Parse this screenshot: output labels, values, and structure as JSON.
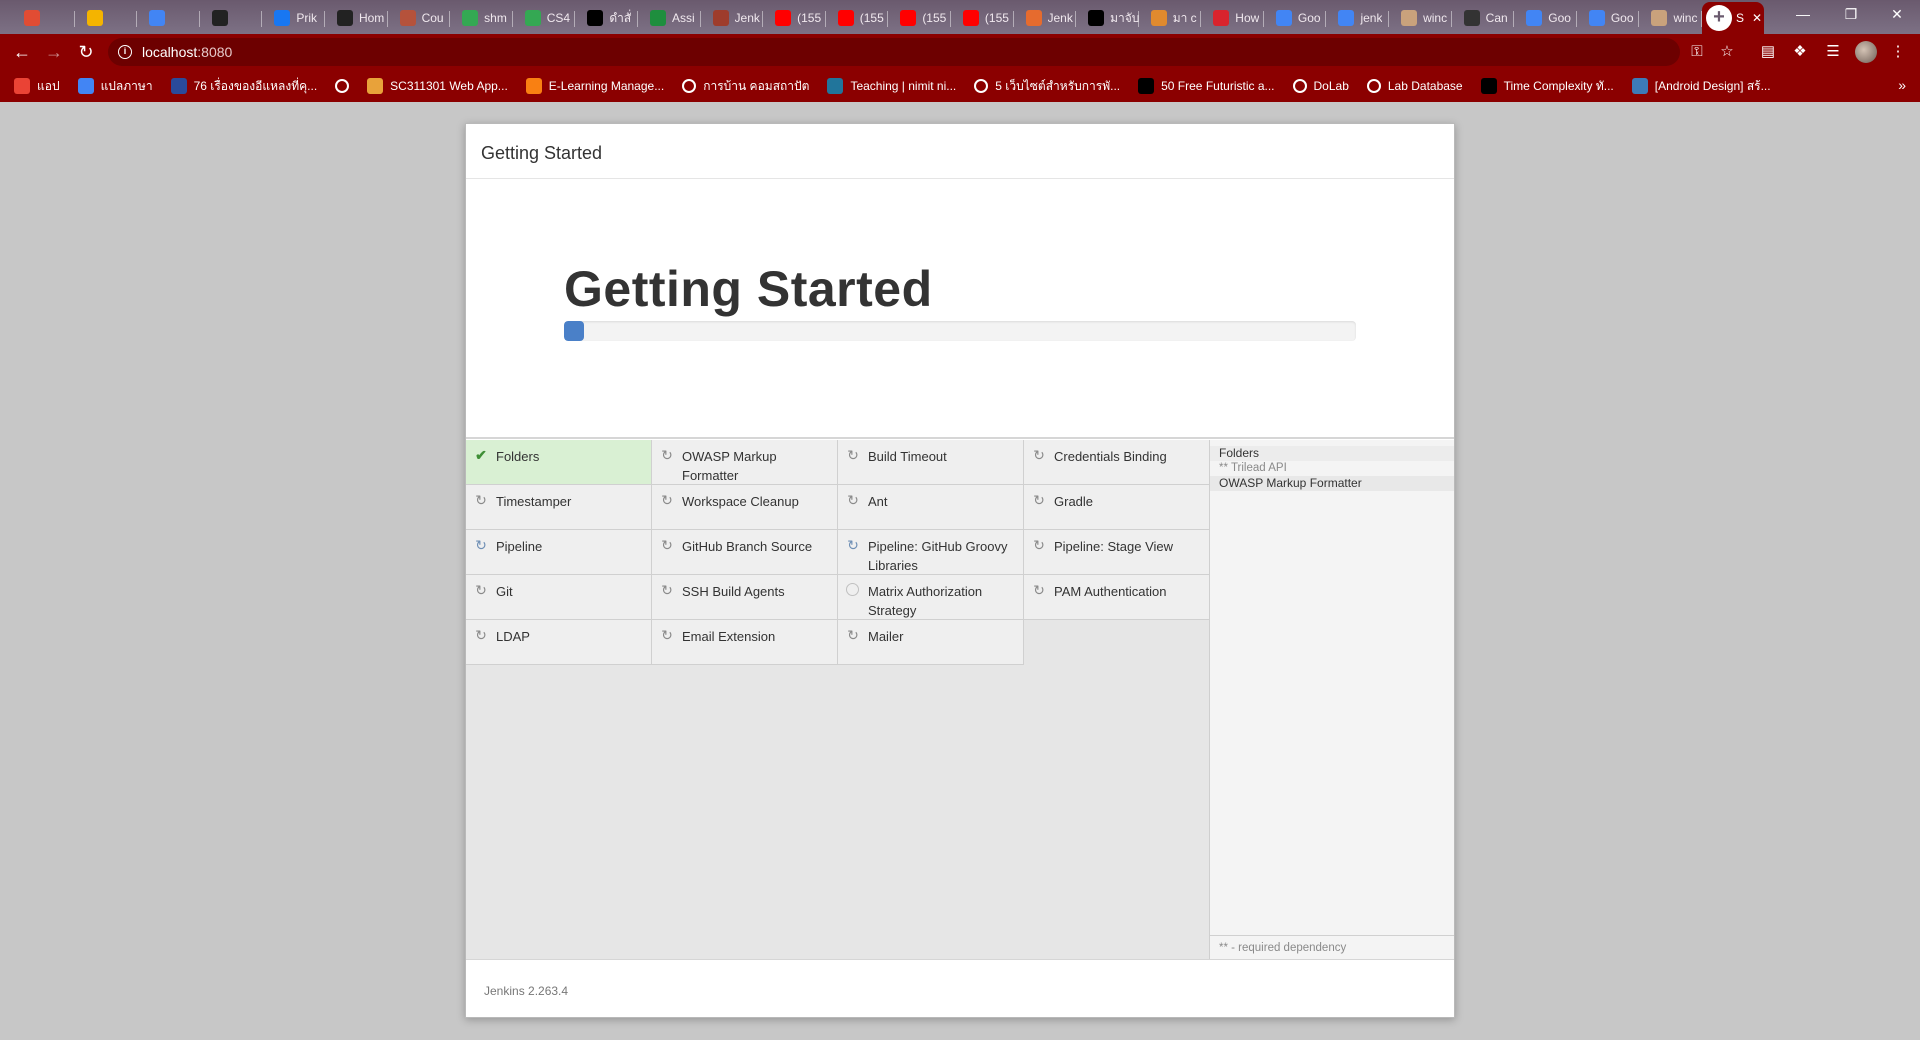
{
  "browser": {
    "tabs": [
      {
        "title": "",
        "icon": "warning-icon",
        "color": "#e14c33"
      },
      {
        "title": "",
        "icon": "drive-icon",
        "color": "#f4b400"
      },
      {
        "title": "",
        "icon": "contacts-icon",
        "color": "#4285f4"
      },
      {
        "title": "",
        "icon": "github-icon",
        "color": "#222222"
      },
      {
        "title": "Prik",
        "icon": "facebook-icon",
        "color": "#1877f2"
      },
      {
        "title": "Hom",
        "icon": "github-icon",
        "color": "#222222"
      },
      {
        "title": "Cou",
        "icon": "coursera-icon",
        "color": "#b5523b"
      },
      {
        "title": "shm",
        "icon": "drive-icon",
        "color": "#34a853"
      },
      {
        "title": "CS4",
        "icon": "drive-icon",
        "color": "#34a853"
      },
      {
        "title": "ดำสั่",
        "icon": "medium-icon",
        "color": "#000000"
      },
      {
        "title": "Assi",
        "icon": "classroom-icon",
        "color": "#1e8e3e"
      },
      {
        "title": "Jenk",
        "icon": "jenkins-icon",
        "color": "#9e3c2c"
      },
      {
        "title": "(155",
        "icon": "youtube-icon",
        "color": "#ff0000"
      },
      {
        "title": "(155",
        "icon": "youtube-icon",
        "color": "#ff0000"
      },
      {
        "title": "(155",
        "icon": "youtube-icon",
        "color": "#ff0000"
      },
      {
        "title": "(155",
        "icon": "youtube-icon",
        "color": "#ff0000"
      },
      {
        "title": "Jenk",
        "icon": "jenkins-icon",
        "color": "#e66b2e"
      },
      {
        "title": "มาจับ",
        "icon": "medium-icon",
        "color": "#000000"
      },
      {
        "title": "มา c",
        "icon": "gear-icon",
        "color": "#e08a2e"
      },
      {
        "title": "How",
        "icon": "codeonline-icon",
        "color": "#d9232d"
      },
      {
        "title": "Goo",
        "icon": "translate-icon",
        "color": "#4285f4"
      },
      {
        "title": "jenk",
        "icon": "google-icon",
        "color": "#4285f4"
      },
      {
        "title": "winc",
        "icon": "windows-icon",
        "color": "#c9a27c"
      },
      {
        "title": "Can",
        "icon": "canvas-icon",
        "color": "#333333"
      },
      {
        "title": "Goo",
        "icon": "translate-icon",
        "color": "#4285f4"
      },
      {
        "title": "Goo",
        "icon": "translate-icon",
        "color": "#4285f4"
      },
      {
        "title": "winc",
        "icon": "windows-icon",
        "color": "#c9a27c"
      },
      {
        "title": "S",
        "icon": "jenkins-icon",
        "color": "#bba18a",
        "active": true
      }
    ],
    "new_tab_label": "+",
    "window_controls": {
      "minimize": "—",
      "restore": "❐",
      "close": "✕"
    },
    "url_host": "localhost",
    "url_port": ":8080",
    "bookmarks": [
      {
        "label": "แอป",
        "icon": "apps-icon",
        "color": "#ea4335"
      },
      {
        "label": "แปลภาษา",
        "icon": "translate-icon",
        "color": "#4285f4"
      },
      {
        "label": "76 เรื่องของอีแหลงที่คุ...",
        "icon": "blog-icon",
        "color": "#2a4a9b"
      },
      {
        "label": "",
        "icon": "globe-icon",
        "color": "#ffffff"
      },
      {
        "label": "SC311301 Web App...",
        "icon": "course-icon",
        "color": "#e8a23a"
      },
      {
        "label": "E-Learning Manage...",
        "icon": "moodle-icon",
        "color": "#f98012"
      },
      {
        "label": "การบ้าน คอมสถาปัต",
        "icon": "globe-icon",
        "color": "#ffffff"
      },
      {
        "label": "Teaching | nimit ni...",
        "icon": "wordpress-icon",
        "color": "#21759b"
      },
      {
        "label": "5 เว็บไซต์สำหรับการพั...",
        "icon": "site-icon",
        "color": "#ffffff"
      },
      {
        "label": "50 Free Futuristic a...",
        "icon": "medium-icon",
        "color": "#000000"
      },
      {
        "label": "DoLab",
        "icon": "globe-icon",
        "color": "#ffffff"
      },
      {
        "label": "Lab Database",
        "icon": "globe-icon",
        "color": "#ffffff"
      },
      {
        "label": "Time Complexity ทั...",
        "icon": "medium-icon",
        "color": "#000000"
      },
      {
        "label": "[Android Design] สร้...",
        "icon": "image-icon",
        "color": "#3d7ab8"
      }
    ],
    "bookmarks_more": "»"
  },
  "dialog": {
    "header_title": "Getting Started",
    "hero_title": "Getting Started",
    "progress_fraction": 0.025,
    "accent_color": "#4a80c8",
    "plugins": [
      {
        "name": "Folders",
        "status": "done"
      },
      {
        "name": "OWASP Markup Formatter",
        "status": "waiting"
      },
      {
        "name": "Build Timeout",
        "status": "waiting"
      },
      {
        "name": "Credentials Binding",
        "status": "waiting"
      },
      {
        "name": "Timestamper",
        "status": "waiting"
      },
      {
        "name": "Workspace Cleanup",
        "status": "waiting"
      },
      {
        "name": "Ant",
        "status": "waiting"
      },
      {
        "name": "Gradle",
        "status": "waiting"
      },
      {
        "name": "Pipeline",
        "status": "installing"
      },
      {
        "name": "GitHub Branch Source",
        "status": "waiting"
      },
      {
        "name": "Pipeline: GitHub Groovy Libraries",
        "status": "installing"
      },
      {
        "name": "Pipeline: Stage View",
        "status": "waiting"
      },
      {
        "name": "Git",
        "status": "waiting"
      },
      {
        "name": "SSH Build Agents",
        "status": "waiting"
      },
      {
        "name": "Matrix Authorization Strategy",
        "status": "pending"
      },
      {
        "name": "PAM Authentication",
        "status": "waiting"
      },
      {
        "name": "LDAP",
        "status": "waiting"
      },
      {
        "name": "Email Extension",
        "status": "waiting"
      },
      {
        "name": "Mailer",
        "status": "waiting"
      }
    ],
    "install_log": [
      {
        "text": "Folders",
        "kind": "plugin"
      },
      {
        "text": "** Trilead API",
        "kind": "dependency"
      },
      {
        "text": "OWASP Markup Formatter",
        "kind": "plugin"
      }
    ],
    "legend": "** - required dependency",
    "footer_version": "Jenkins 2.263.4"
  }
}
